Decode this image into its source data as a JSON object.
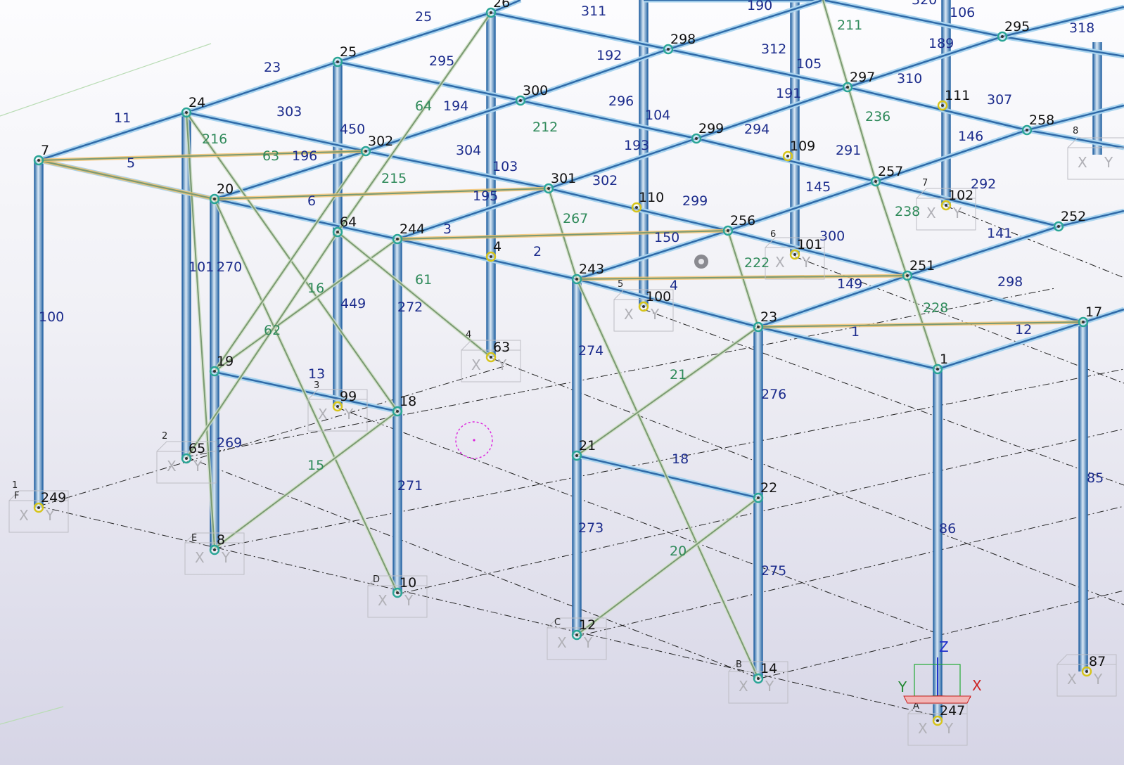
{
  "view": {
    "title": ""
  },
  "colors": {
    "column": "#2f6aa8",
    "column_light": "#a9d4ef",
    "bracing": "#7a9a72",
    "bracing_highlight": "#f2c16a",
    "node_ring": "#2aa596",
    "support_node": "#d6c41a",
    "grid_line": "#222222",
    "axis_x": "#cc2222",
    "axis_y": "#228833",
    "axis_z": "#2233cc",
    "pivot": "#dd22dd"
  },
  "node_labels": [
    {
      "id": "n7",
      "text": "7"
    },
    {
      "id": "n24",
      "text": "24"
    },
    {
      "id": "n25",
      "text": "25"
    },
    {
      "id": "n26",
      "text": "26"
    },
    {
      "id": "n20",
      "text": "20"
    },
    {
      "id": "n302",
      "text": "302"
    },
    {
      "id": "n64",
      "text": "64"
    },
    {
      "id": "n244",
      "text": "244"
    },
    {
      "id": "n300",
      "text": "300"
    },
    {
      "id": "n298",
      "text": "298"
    },
    {
      "id": "n301",
      "text": "301"
    },
    {
      "id": "n299",
      "text": "299"
    },
    {
      "id": "n297",
      "text": "297"
    },
    {
      "id": "n295",
      "text": "295"
    },
    {
      "id": "n258",
      "text": "258"
    },
    {
      "id": "n257",
      "text": "257"
    },
    {
      "id": "n256",
      "text": "256"
    },
    {
      "id": "n252",
      "text": "252"
    },
    {
      "id": "n251",
      "text": "251"
    },
    {
      "id": "n243",
      "text": "243"
    },
    {
      "id": "n23",
      "text": "23"
    },
    {
      "id": "n1",
      "text": "1"
    },
    {
      "id": "n17",
      "text": "17"
    },
    {
      "id": "n19",
      "text": "19"
    },
    {
      "id": "n18",
      "text": "18"
    },
    {
      "id": "n21",
      "text": "21"
    },
    {
      "id": "n22",
      "text": "22"
    },
    {
      "id": "n4",
      "text": "4"
    },
    {
      "id": "n63",
      "text": "63"
    },
    {
      "id": "n99",
      "text": "99"
    },
    {
      "id": "n65",
      "text": "65"
    },
    {
      "id": "n249",
      "text": "249"
    },
    {
      "id": "n8",
      "text": "8"
    },
    {
      "id": "n10",
      "text": "10"
    },
    {
      "id": "n12",
      "text": "12"
    },
    {
      "id": "n14",
      "text": "14"
    },
    {
      "id": "n247",
      "text": "247"
    },
    {
      "id": "n100",
      "text": "100"
    },
    {
      "id": "n101",
      "text": "101"
    },
    {
      "id": "n102",
      "text": "102"
    },
    {
      "id": "n109",
      "text": "109"
    },
    {
      "id": "n110",
      "text": "110"
    },
    {
      "id": "n111",
      "text": "111"
    },
    {
      "id": "n87",
      "text": "87"
    }
  ],
  "member_labels_blue": [
    "25",
    "311",
    "190",
    "320",
    "106",
    "318",
    "23",
    "295",
    "312",
    "105",
    "192",
    "189",
    "11",
    "303",
    "450",
    "194",
    "296",
    "104",
    "191",
    "310",
    "307",
    "5",
    "196",
    "304",
    "193",
    "294",
    "291",
    "146",
    "103",
    "302",
    "299",
    "145",
    "292",
    "6",
    "195",
    "3",
    "2",
    "150",
    "141",
    "4",
    "149",
    "298",
    "12",
    "1",
    "100",
    "101",
    "270",
    "449",
    "272",
    "274",
    "276",
    "13",
    "269",
    "271",
    "18",
    "273",
    "275",
    "86",
    "85",
    "300"
  ],
  "member_labels_green": [
    "211",
    "64",
    "212",
    "236",
    "216",
    "63",
    "215",
    "267",
    "238",
    "222",
    "228",
    "16",
    "61",
    "62",
    "21",
    "15",
    "20"
  ],
  "grid_labels": [
    "1",
    "F",
    "2",
    "E",
    "3",
    "D",
    "4",
    "C",
    "5",
    "B",
    "6",
    "A",
    "7",
    "8"
  ],
  "support_axis_label_x": "X",
  "support_axis_label_y": "Y",
  "axes": {
    "x": "X",
    "y": "Y",
    "z": "Z"
  }
}
